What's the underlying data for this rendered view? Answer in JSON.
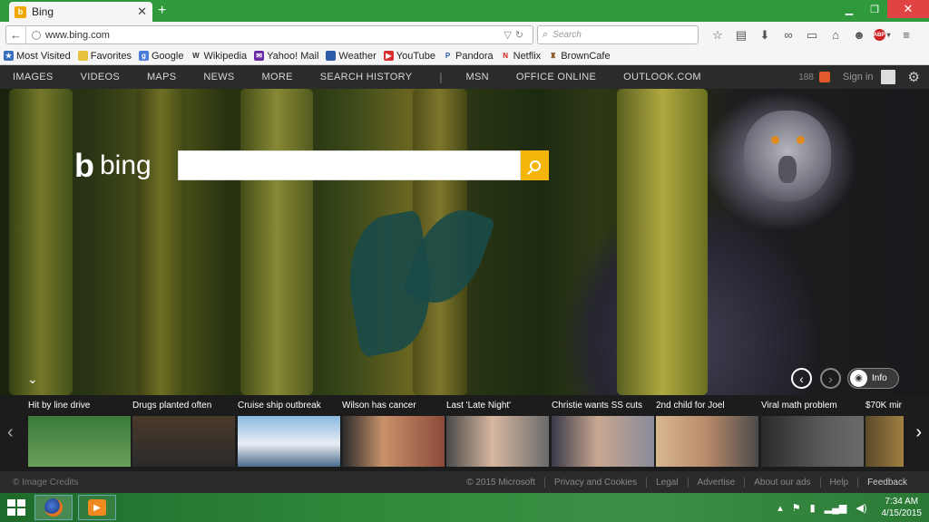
{
  "browser": {
    "tab_title": "Bing",
    "url": "www.bing.com",
    "search_placeholder": "Search"
  },
  "bookmarks": [
    {
      "label": "Most Visited",
      "icon": "bookmarks-star-icon",
      "color": "#3a6fc0"
    },
    {
      "label": "Favorites",
      "icon": "folder-icon",
      "color": "#e8c040"
    },
    {
      "label": "Google",
      "icon": "google-icon",
      "color": "#4a7ad8"
    },
    {
      "label": "Wikipedia",
      "icon": "wikipedia-icon",
      "color": "#666666"
    },
    {
      "label": "Yahoo! Mail",
      "icon": "yahoo-icon",
      "color": "#6a2aa8"
    },
    {
      "label": "Weather",
      "icon": "weather-icon",
      "color": "#2a5aa8"
    },
    {
      "label": "YouTube",
      "icon": "youtube-icon",
      "color": "#d83030"
    },
    {
      "label": "Pandora",
      "icon": "pandora-icon",
      "color": "#2a5aa8"
    },
    {
      "label": "Netflix",
      "icon": "netflix-icon",
      "color": "#d82020"
    },
    {
      "label": "BrownCafe",
      "icon": "browncafe-icon",
      "color": "#8a5a2a"
    }
  ],
  "bing_nav": {
    "left": [
      "IMAGES",
      "VIDEOS",
      "MAPS",
      "NEWS",
      "MORE",
      "SEARCH HISTORY"
    ],
    "right": [
      "MSN",
      "OFFICE ONLINE",
      "OUTLOOK.COM"
    ],
    "separator": "|",
    "rewards_points": "188",
    "sign_in": "Sign in"
  },
  "brand": {
    "logo_text": "bing",
    "accent_color": "#f5b50a"
  },
  "hero": {
    "info_label": "Info"
  },
  "news": [
    {
      "title": "Hit by line drive",
      "color": "#3a7a3a"
    },
    {
      "title": "Drugs planted often",
      "color": "#4a3a2a"
    },
    {
      "title": "Cruise ship outbreak",
      "color": "#5a8ab8"
    },
    {
      "title": "Wilson has cancer",
      "color": "#8a4a3a"
    },
    {
      "title": "Last 'Late Night'",
      "color": "#6a6a6a"
    },
    {
      "title": "Christie wants SS cuts",
      "color": "#3a3a4a"
    },
    {
      "title": "2nd child for Joel",
      "color": "#b88a6a"
    },
    {
      "title": "Viral math problem",
      "color": "#3a3a3a"
    },
    {
      "title": "$70K mir",
      "color": "#5a4a2a"
    }
  ],
  "footer": {
    "credits": "© Image Credits",
    "links": [
      "© 2015 Microsoft",
      "Privacy and Cookies",
      "Legal",
      "Advertise",
      "About our ads",
      "Help",
      "Feedback"
    ]
  },
  "taskbar": {
    "time": "7:34 AM",
    "date": "4/15/2015"
  }
}
